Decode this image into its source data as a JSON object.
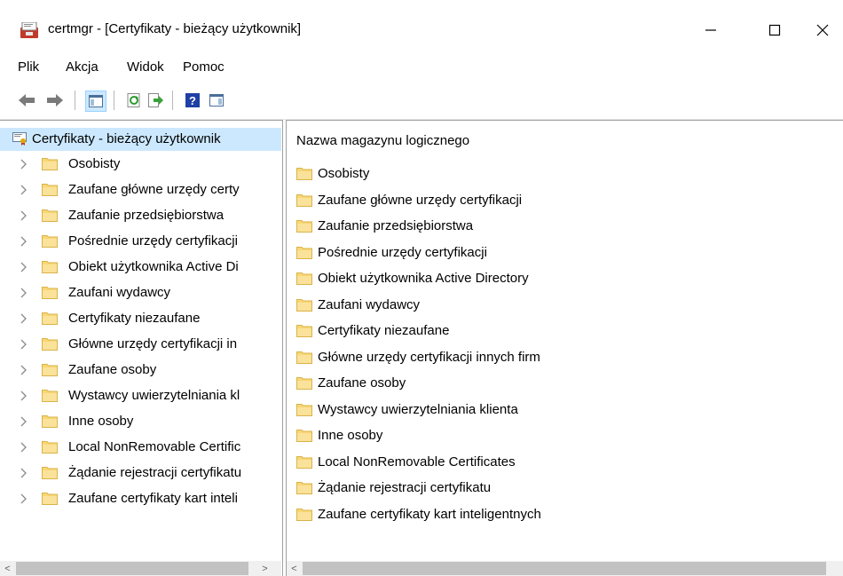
{
  "window": {
    "title": "certmgr - [Certyfikaty - bieżący użytkownik]",
    "icon": "certificate-manager-icon",
    "controls": [
      "minimize-icon",
      "maximize-icon",
      "close-icon"
    ]
  },
  "menu": {
    "items": [
      {
        "label": "Plik"
      },
      {
        "label": "Akcja"
      },
      {
        "label": "Widok"
      },
      {
        "label": "Pomoc"
      }
    ]
  },
  "toolbar": {
    "buttons": [
      "back-arrow-icon",
      "forward-arrow-icon",
      "show-hide-console-tree-icon",
      "refresh-icon",
      "export-list-icon",
      "help-icon",
      "show-hide-action-pane-icon"
    ]
  },
  "tree": {
    "root_label": "Certyfikaty - bieżący użytkownik",
    "items": [
      {
        "label": "Osobisty"
      },
      {
        "label": "Zaufane główne urzędy certy"
      },
      {
        "label": "Zaufanie przedsiębiorstwa"
      },
      {
        "label": "Pośrednie urzędy certyfikacji"
      },
      {
        "label": "Obiekt użytkownika Active Di"
      },
      {
        "label": "Zaufani wydawcy"
      },
      {
        "label": "Certyfikaty niezaufane"
      },
      {
        "label": "Główne urzędy certyfikacji in"
      },
      {
        "label": "Zaufane osoby"
      },
      {
        "label": "Wystawcy uwierzytelniania kl"
      },
      {
        "label": "Inne osoby"
      },
      {
        "label": "Local NonRemovable Certific"
      },
      {
        "label": "Żądanie rejestracji certyfikatu"
      },
      {
        "label": "Zaufane certyfikaty kart inteli"
      }
    ]
  },
  "list": {
    "column_header": "Nazwa magazynu logicznego",
    "items": [
      {
        "label": "Osobisty"
      },
      {
        "label": "Zaufane główne urzędy certyfikacji"
      },
      {
        "label": "Zaufanie przedsiębiorstwa"
      },
      {
        "label": "Pośrednie urzędy certyfikacji"
      },
      {
        "label": "Obiekt użytkownika Active Directory"
      },
      {
        "label": "Zaufani wydawcy"
      },
      {
        "label": "Certyfikaty niezaufane"
      },
      {
        "label": "Główne urzędy certyfikacji innych firm"
      },
      {
        "label": "Zaufane osoby"
      },
      {
        "label": "Wystawcy uwierzytelniania klienta"
      },
      {
        "label": "Inne osoby"
      },
      {
        "label": "Local NonRemovable Certificates"
      },
      {
        "label": "Żądanie rejestracji certyfikatu"
      },
      {
        "label": "Zaufane certyfikaty kart inteligentnych"
      }
    ]
  },
  "colors": {
    "selection": "#cce8ff",
    "folder": "#f8d775",
    "pane_border": "#a0a0a0"
  }
}
